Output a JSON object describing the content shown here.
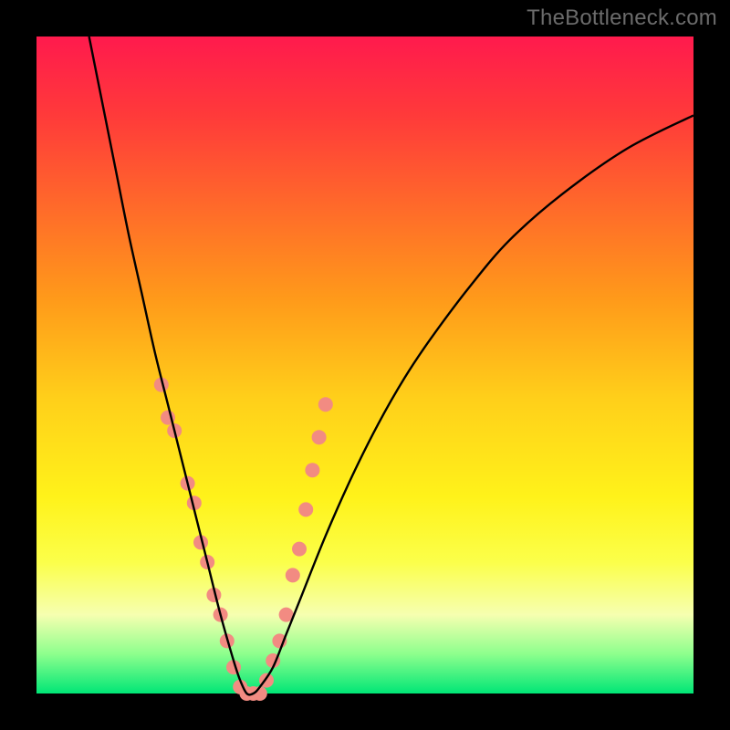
{
  "watermark": "TheBottleneck.com",
  "chart_data": {
    "type": "line",
    "title": "",
    "xlabel": "",
    "ylabel": "",
    "xlim": [
      0,
      100
    ],
    "ylim": [
      0,
      100
    ],
    "grid": false,
    "annotations": [],
    "series": [
      {
        "name": "bottleneck-curve",
        "color": "#000000",
        "x": [
          8,
          10,
          12,
          14,
          16,
          18,
          20,
          22,
          24,
          26,
          28,
          30,
          31,
          32,
          33,
          34,
          36,
          38,
          40,
          44,
          48,
          52,
          56,
          60,
          66,
          72,
          80,
          90,
          100
        ],
        "y": [
          100,
          90,
          80,
          70,
          61,
          52,
          44,
          36,
          28,
          20,
          12,
          5,
          2,
          0,
          0,
          1,
          4,
          9,
          14,
          24,
          33,
          41,
          48,
          54,
          62,
          69,
          76,
          83,
          88
        ]
      }
    ],
    "markers": {
      "name": "highlighted-points",
      "color": "#f28b82",
      "radius_px": 8,
      "points": [
        {
          "x": 19,
          "y": 47
        },
        {
          "x": 20,
          "y": 42
        },
        {
          "x": 21,
          "y": 40
        },
        {
          "x": 23,
          "y": 32
        },
        {
          "x": 24,
          "y": 29
        },
        {
          "x": 25,
          "y": 23
        },
        {
          "x": 26,
          "y": 20
        },
        {
          "x": 27,
          "y": 15
        },
        {
          "x": 28,
          "y": 12
        },
        {
          "x": 29,
          "y": 8
        },
        {
          "x": 30,
          "y": 4
        },
        {
          "x": 31,
          "y": 1
        },
        {
          "x": 32,
          "y": 0
        },
        {
          "x": 33,
          "y": 0
        },
        {
          "x": 34,
          "y": 0
        },
        {
          "x": 35,
          "y": 2
        },
        {
          "x": 36,
          "y": 5
        },
        {
          "x": 37,
          "y": 8
        },
        {
          "x": 38,
          "y": 12
        },
        {
          "x": 39,
          "y": 18
        },
        {
          "x": 40,
          "y": 22
        },
        {
          "x": 41,
          "y": 28
        },
        {
          "x": 42,
          "y": 34
        },
        {
          "x": 43,
          "y": 39
        },
        {
          "x": 44,
          "y": 44
        }
      ]
    }
  }
}
